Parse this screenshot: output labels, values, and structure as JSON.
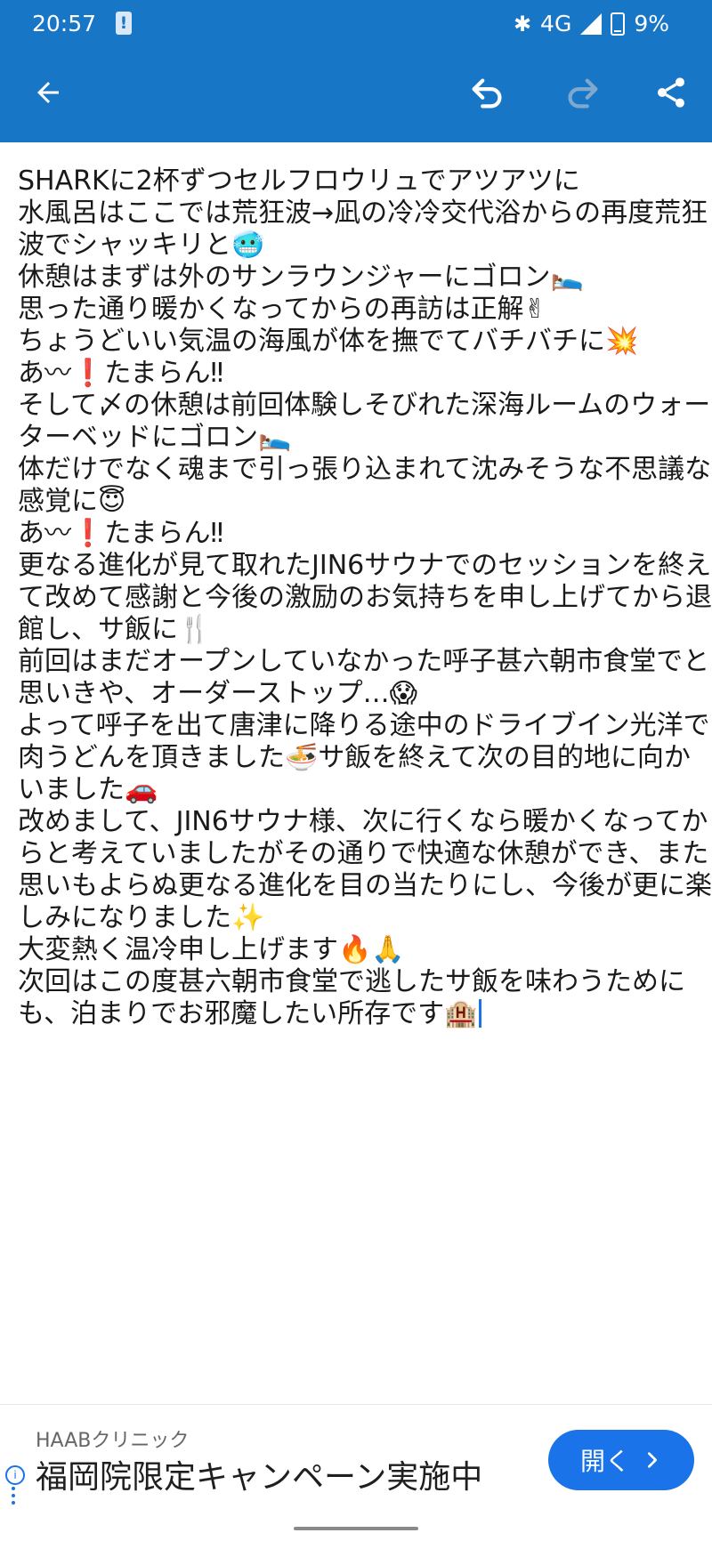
{
  "status_bar": {
    "time": "20:57",
    "alert_icon": "!",
    "network": "4G",
    "battery": "9%"
  },
  "toolbar": {
    "back_icon": "←",
    "undo_icon": "undo",
    "redo_icon": "redo",
    "share_icon": "share"
  },
  "content": {
    "lines": [
      "SHARKに2杯ずつセルフロウリュでアツアツに",
      "水風呂はここでは荒狂波→凪の冷冷交代浴からの再度荒狂波でシャッキリと🥶",
      "休憩はまずは外のサンラウンジャーにゴロン🛌",
      "思った通り暖かくなってからの再訪は正解✌",
      "ちょうどいい気温の海風が体を撫でてバチバチに💥",
      "あ〰❗たまらん‼",
      "そして〆の休憩は前回体験しそびれた深海ルームのウォーターベッドにゴロン🛌",
      "体だけでなく魂まで引っ張り込まれて沈みそうな不思議な感覚に😇",
      "あ〰❗たまらん‼",
      "更なる進化が見て取れたJIN6サウナでのセッションを終えて改めて感謝と今後の激励のお気持ちを申し上げてから退館し、サ飯に🍴",
      "前回はまだオープンしていなかった呼子甚六朝市食堂でと思いきや、オーダーストップ…😱",
      "よって呼子を出て唐津に降りる途中のドライブイン光洋で肉うどんを頂きました🍜サ飯を終えて次の目的地に向かいました🚗",
      "改めまして、JIN6サウナ様、次に行くなら暖かくなってからと考えていましたがその通りで快適な休憩ができ、また思いもよらぬ更なる進化を目の当たりにし、今後が更に楽しみになりました✨",
      "大変熱く温冷申し上げます🔥🙏",
      "次回はこの度甚六朝市食堂で逃したサ飯を味わうためにも、泊まりでお邪魔したい所存です🏨"
    ]
  },
  "ad": {
    "brand": "HAABクリニック",
    "headline": "福岡院限定キャンペーン実施中",
    "button_label": "開く",
    "button_icon": "chevron-right-icon",
    "info_icon": "i"
  },
  "colors": {
    "appbar": "#1876c6",
    "ad_button": "#1a73e8"
  }
}
